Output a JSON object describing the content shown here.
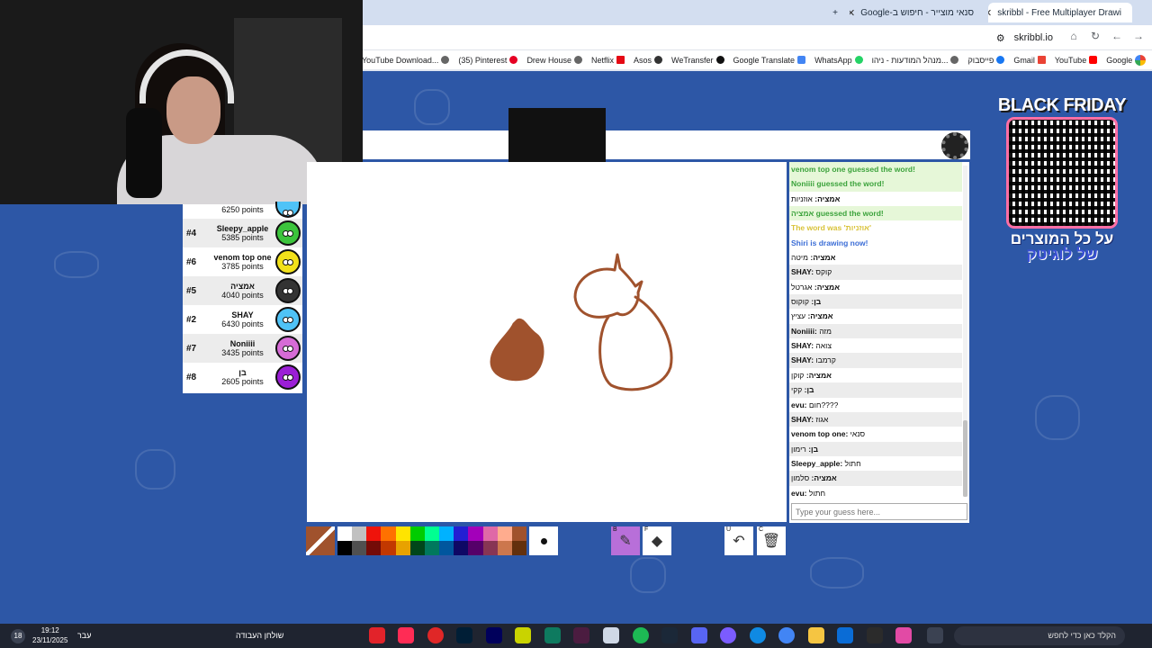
{
  "browser": {
    "tabs": [
      {
        "title": "skribbl - Free Multiplayer Drawi",
        "close": "✕"
      },
      {
        "title": "סנאי מוצייר - חיפוש ב-Google",
        "close": "✕"
      }
    ],
    "new_tab": "+",
    "url": "skribbl.io",
    "bookmarks": [
      "YouTube Download...",
      "(35) Pinterest",
      "Drew House",
      "Netflix",
      "Asos",
      "WeTransfer",
      "Google Translate",
      "WhatsApp",
      "מנהל המודעות - ניהו...",
      "פייסבוק",
      "Gmail",
      "YouTube",
      "Google"
    ]
  },
  "game": {
    "players": [
      {
        "rank": "",
        "name": "",
        "points": "6250 points",
        "color": "#4fc3f7"
      },
      {
        "rank": "#4",
        "name": "Sleepy_apple",
        "points": "5385 points",
        "color": "#3cc43c"
      },
      {
        "rank": "#6",
        "name": "venom top one",
        "points": "3785 points",
        "color": "#f2e11a"
      },
      {
        "rank": "#5",
        "name": "אמציה",
        "points": "4040 points",
        "color": "#333333"
      },
      {
        "rank": "#2",
        "name": "SHAY",
        "points": "6430 points",
        "color": "#4fc3f7"
      },
      {
        "rank": "#7",
        "name": "Noniiii",
        "points": "3435 points",
        "color": "#d66bd6"
      },
      {
        "rank": "#8",
        "name": "בן",
        "points": "2605 points",
        "color": "#9b1ed6"
      }
    ],
    "chat": [
      {
        "type": "green",
        "user": "",
        "text": "venom top one guessed the word!"
      },
      {
        "type": "green",
        "user": "",
        "text": "Noniiii guessed the word!"
      },
      {
        "type": "normal",
        "user": "אמציה:",
        "text": "אוזניות"
      },
      {
        "type": "green",
        "user": "",
        "text": "אמציה guessed the word!"
      },
      {
        "type": "yellow",
        "user": "",
        "text": "The word was 'אוזניות'"
      },
      {
        "type": "blue",
        "user": "",
        "text": "Shiri is drawing now!"
      },
      {
        "type": "normal",
        "user": "אמציה:",
        "text": "מיטה"
      },
      {
        "type": "normal",
        "user": "SHAY:",
        "text": "קוקס"
      },
      {
        "type": "normal",
        "user": "אמציה:",
        "text": "אגרטל"
      },
      {
        "type": "normal",
        "user": "בן:",
        "text": "קוקוס"
      },
      {
        "type": "normal",
        "user": "אמציה:",
        "text": "עציץ"
      },
      {
        "type": "normal",
        "user": "Noniiii:",
        "text": "מזה"
      },
      {
        "type": "normal",
        "user": "SHAY:",
        "text": "צואה"
      },
      {
        "type": "normal",
        "user": "SHAY:",
        "text": "קרמבו"
      },
      {
        "type": "normal",
        "user": "אמציה:",
        "text": "קוקן"
      },
      {
        "type": "normal",
        "user": "בן:",
        "text": "קקי"
      },
      {
        "type": "normal",
        "user": "evu:",
        "text": "חום????"
      },
      {
        "type": "normal",
        "user": "SHAY:",
        "text": "אגוז"
      },
      {
        "type": "normal",
        "user": "venom top one:",
        "text": "סנאי"
      },
      {
        "type": "normal",
        "user": "בן:",
        "text": "רימון"
      },
      {
        "type": "normal",
        "user": "Sleepy_apple:",
        "text": "חתול"
      },
      {
        "type": "normal",
        "user": "אמציה:",
        "text": "סלמון"
      },
      {
        "type": "normal",
        "user": "evu:",
        "text": "חתול"
      }
    ],
    "guess_placeholder": "Type your guess here...",
    "palette": [
      "#ffffff",
      "#c1c1c1",
      "#ef130b",
      "#ff7100",
      "#ffe400",
      "#00cc00",
      "#00ff91",
      "#00b2ff",
      "#231fd3",
      "#a300ba",
      "#df69a7",
      "#ffac8e",
      "#a0522d",
      "#000000",
      "#505050",
      "#740b07",
      "#c23800",
      "#e8a200",
      "#004619",
      "#00785d",
      "#00569e",
      "#0e0865",
      "#550069",
      "#873554",
      "#cc774d",
      "#63300d"
    ],
    "current_color": "#a0522d",
    "tools": [
      {
        "key": "B",
        "name": "brush"
      },
      {
        "key": "F",
        "name": "fill"
      },
      {
        "key": "U",
        "name": "undo"
      },
      {
        "key": "C",
        "name": "clear"
      }
    ]
  },
  "promo": {
    "title": "BLACK FRIDAY",
    "line1": "על כל המוצרים",
    "line2": "של לוגיטק"
  },
  "taskbar": {
    "time": "19:12",
    "date": "23/11/2025",
    "lang": "עבר",
    "workspace": "שולחן העבודה",
    "search_placeholder": "הקלד כאן כדי לחפש",
    "notif": "18"
  }
}
